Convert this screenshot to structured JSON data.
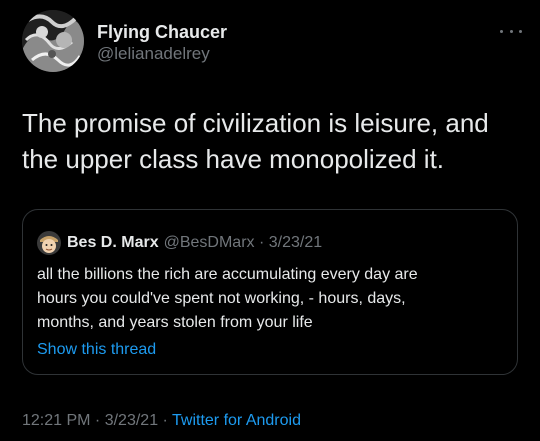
{
  "author": {
    "display_name": "Flying Chaucer",
    "handle": "@lelianadelrey",
    "avatar_icon": "ornate-illustration-avatar"
  },
  "more_menu_icon": "more-horizontal-icon",
  "tweet": {
    "text": "The promise of civilization is leisure, and the upper class have monopolized it."
  },
  "quoted_tweet": {
    "display_name": "Bes D. Marx",
    "meta": "@BesDMarx · 3/23/21",
    "avatar_icon": "cartoon-face-avatar",
    "lines": [
      "all the billions the rich are accumulating every day are",
      "hours you could've spent not working, - hours, days,",
      "months, and years stolen from your life"
    ],
    "show_thread": "Show this thread"
  },
  "footer": {
    "time_date": "12:21 PM · 3/23/21 · ",
    "client": "Twitter for Android"
  },
  "colors": {
    "background": "#000000",
    "primary_text": "#e7e9ea",
    "secondary_text": "#71767b",
    "link": "#1d9bf0",
    "border": "#2f3336"
  }
}
